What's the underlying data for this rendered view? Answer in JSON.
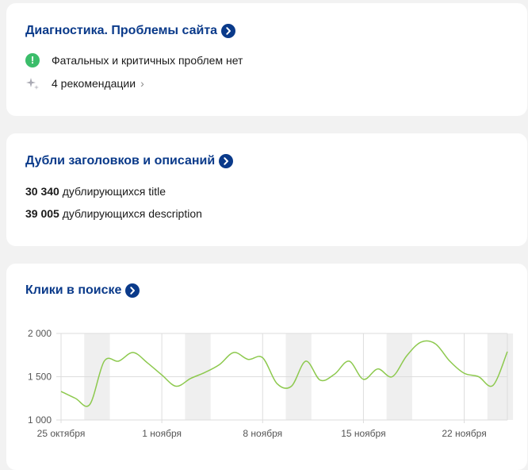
{
  "diagnostics": {
    "title": "Диагностика. Проблемы сайта",
    "status_text": "Фатальных и критичных проблем нет",
    "recommendations_text": "4 рекомендации",
    "status_icon": "check-icon",
    "status_color": "#3bbd6a"
  },
  "duplicates": {
    "title": "Дубли заголовков и описаний",
    "title_count": "30 340",
    "title_text": "дублирующихся title",
    "description_count": "39 005",
    "description_text": "дублирующихся description"
  },
  "clicks": {
    "title": "Клики в поиске"
  },
  "colors": {
    "accent": "#0a3a8a",
    "line": "#8dc94e",
    "weekend": "#efefef"
  },
  "chart_data": {
    "type": "line",
    "ylim": [
      1000,
      2000
    ],
    "yticks": [
      "2 000",
      "1 500",
      "1 000"
    ],
    "xtick_labels": [
      "25 октября",
      "1 ноября",
      "8 ноября",
      "15 ноября",
      "22 ноября"
    ],
    "x_start": "2023-10-25",
    "series": [
      {
        "values": [
          1330,
          1250,
          1180,
          1680,
          1680,
          1780,
          1660,
          1520,
          1390,
          1480,
          1550,
          1640,
          1780,
          1700,
          1720,
          1420,
          1390,
          1680,
          1460,
          1530,
          1680,
          1470,
          1590,
          1500,
          1740,
          1900,
          1880,
          1680,
          1540,
          1500,
          1400,
          1790
        ]
      }
    ],
    "weekend_spans": [
      [
        2,
        3
      ],
      [
        9,
        10
      ],
      [
        16,
        17
      ],
      [
        23,
        24
      ],
      [
        30,
        31
      ]
    ],
    "grid": true
  }
}
